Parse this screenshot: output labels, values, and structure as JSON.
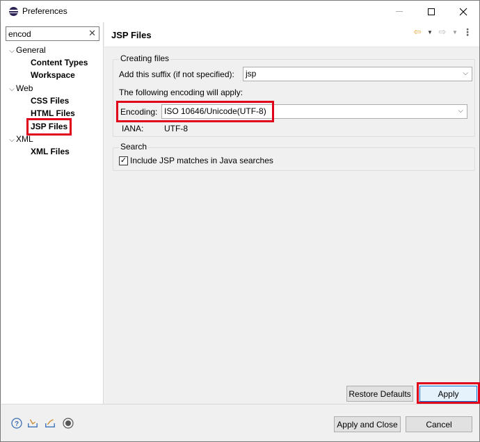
{
  "window": {
    "title": "Preferences"
  },
  "filter": {
    "value": "encod",
    "clear_label": "✕"
  },
  "tree": [
    {
      "label": "General",
      "level": 0,
      "expanded": true
    },
    {
      "label": "Content Types",
      "level": 1
    },
    {
      "label": "Workspace",
      "level": 1
    },
    {
      "label": "Web",
      "level": 0,
      "expanded": true
    },
    {
      "label": "CSS Files",
      "level": 1
    },
    {
      "label": "HTML Files",
      "level": 1
    },
    {
      "label": "JSP Files",
      "level": 1,
      "selected": true
    },
    {
      "label": "XML",
      "level": 0,
      "expanded": true
    },
    {
      "label": "XML Files",
      "level": 1
    }
  ],
  "page": {
    "title": "JSP Files",
    "creating_group": {
      "title": "Creating files",
      "suffix_label": "Add this suffix (if not specified):",
      "suffix_value": "jsp",
      "encoding_note": "The following encoding will apply:",
      "encoding_label": "Encoding:",
      "encoding_value": "ISO 10646/Unicode(UTF-8)",
      "iana_label": "IANA:",
      "iana_value": "UTF-8"
    },
    "search_group": {
      "title": "Search",
      "include_label": "Include JSP matches in Java searches",
      "include_checked": true
    },
    "restore_defaults_label": "Restore Defaults",
    "apply_label": "Apply"
  },
  "footer": {
    "apply_close_label": "Apply and Close",
    "cancel_label": "Cancel",
    "icons": [
      "help-icon",
      "import-icon",
      "export-icon",
      "record-icon"
    ]
  },
  "colors": {
    "highlight": "#e0001a",
    "accent": "#0078d7"
  }
}
